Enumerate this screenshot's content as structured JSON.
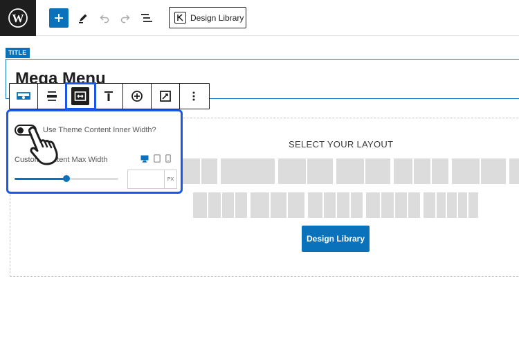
{
  "topbar": {
    "logo_icon": "wordpress-logo-icon",
    "add_icon": "plus-icon",
    "tools_icon": "pencil-icon",
    "undo_icon": "undo-icon",
    "redo_icon": "redo-icon",
    "list_view_icon": "list-view-icon",
    "design_library_label": "Design Library"
  },
  "title_block": {
    "badge": "TITLE",
    "heading": "Mega Menu"
  },
  "block_toolbar": {
    "items": [
      "section-block-icon",
      "align-icon",
      "content-width-icon",
      "vertical-align-icon",
      "add-circle-icon",
      "edit-image-icon",
      "more-options-icon"
    ],
    "active_index": 2
  },
  "width_panel": {
    "toggle_label": "Use Theme Content Inner Width?",
    "toggle_on": false,
    "max_width_label": "Custom Content Max Width",
    "devices": [
      "desktop-icon",
      "tablet-icon",
      "mobile-icon"
    ],
    "slider_fraction": 0.5,
    "input_value": "",
    "unit": "PX"
  },
  "layout": {
    "heading": "SELECT YOUR LAYOUT",
    "button_label": "Design Library"
  },
  "colors": {
    "accent": "#0a72bb",
    "highlight": "#1a56e8",
    "placeholder": "#dcdcdc"
  }
}
